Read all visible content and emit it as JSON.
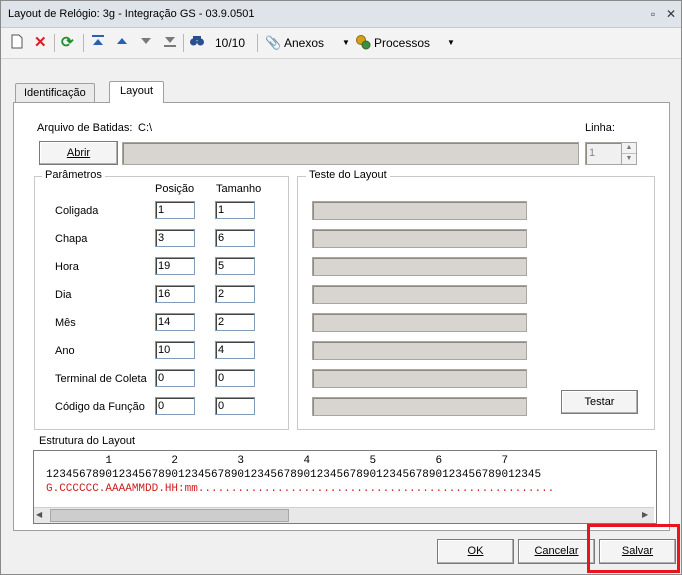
{
  "window": {
    "title": "Layout de Relógio: 3g - Integração  GS - 03.9.0501",
    "controls": [
      "▫",
      "✕"
    ]
  },
  "toolbar": {
    "record_counter": "10/10",
    "attachments_label": "Anexos",
    "processes_label": "Processos"
  },
  "tabs": [
    {
      "label": "Identificação",
      "active": false
    },
    {
      "label": "Layout",
      "active": true
    }
  ],
  "file": {
    "label": "Arquivo de Batidas:",
    "path": "C:\\",
    "open_button": "Abrir",
    "line_label": "Linha:",
    "line_value": "1"
  },
  "parameters": {
    "title": "Parâmetros",
    "col_position": "Posição",
    "col_size": "Tamanho",
    "rows": [
      {
        "label": "Coligada",
        "position": "1",
        "size": "1"
      },
      {
        "label": "Chapa",
        "position": "3",
        "size": "6"
      },
      {
        "label": "Hora",
        "position": "19",
        "size": "5"
      },
      {
        "label": "Dia",
        "position": "16",
        "size": "2"
      },
      {
        "label": "Mês",
        "position": "14",
        "size": "2"
      },
      {
        "label": "Ano",
        "position": "10",
        "size": "4"
      },
      {
        "label": "Terminal de Coleta",
        "position": "0",
        "size": "0"
      },
      {
        "label": "Código da Função",
        "position": "0",
        "size": "0"
      }
    ]
  },
  "test_layout": {
    "title": "Teste do Layout",
    "test_button": "Testar"
  },
  "structure": {
    "title": "Estrutura do Layout",
    "tens_line": "         1         2         3         4         5         6         7",
    "digits_line": "123456789012345678901234567890123456789012345678901234567890123456789012345",
    "layout_line": "G.CCCCCC.AAAAMMDD.HH:mm......................................................"
  },
  "footer": {
    "ok": "OK",
    "cancel": "Cancelar",
    "save": "Salvar"
  },
  "colors": {
    "highlight": "#e8141e",
    "layout_text": "#cc1f1f",
    "disabled_field": "#d8d5d0"
  }
}
